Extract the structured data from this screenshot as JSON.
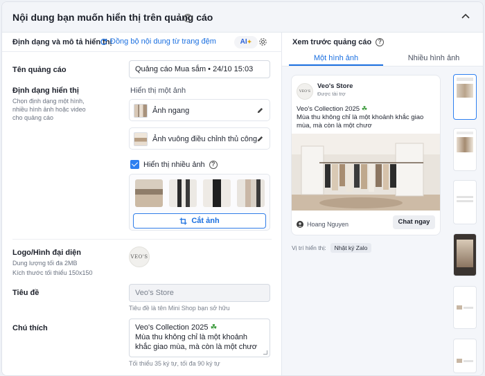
{
  "header": {
    "title": "Nội dung bạn muốn hiển thị trên quảng cáo"
  },
  "left": {
    "section_title": "Định dạng và mô tả hiển thị",
    "sync_label": "Đồng bộ nội dung từ trang đệm",
    "ai_label": "AI",
    "ad_name": {
      "label": "Tên quảng cáo",
      "value": "Quảng cáo Mua sắm • 24/10 15:03"
    },
    "format": {
      "label": "Định dạng hiển thị",
      "description": "Chọn định dạng một hình, nhiều hình ảnh hoặc video cho quảng cáo",
      "single_image_label": "Hiển thị một ảnh",
      "option_landscape": "Ảnh ngang",
      "option_square": "Ảnh vuông điều chỉnh thủ công",
      "multi_image_label": "Hiển thị nhiều ảnh",
      "crop_label": "Cắt ảnh"
    },
    "logo": {
      "label": "Logo/Hình đại diện",
      "desc1": "Dung lượng tối đa 2MB",
      "desc2": "Kích thước tối thiểu 150x150",
      "logo_text": "VEO'S"
    },
    "title": {
      "label": "Tiêu đề",
      "placeholder": "Veo's Store",
      "hint": "Tiêu đề là tên Mini Shop bạn sở hữu"
    },
    "caption": {
      "label": "Chú thích",
      "line1": "Veo's Collection 2025",
      "line2": "Mùa thu không chỉ là một khoảnh khắc giao mùa, mà còn là một chươ",
      "hint": "Tối thiểu 35 ký tự, tối đa 90 ký tự"
    }
  },
  "right": {
    "title": "Xem trước quảng cáo",
    "tabs": [
      "Một hình ảnh",
      "Nhiều hình ảnh"
    ],
    "card": {
      "store": "Veo's Store",
      "sponsored": "Được tài trợ",
      "logo_text": "VEO'S",
      "line1": "Veo's Collection 2025",
      "line2": "Mùa thu không chỉ là một khoảnh khắc giao mùa, mà còn là một chươ",
      "user": "Hoang Nguyen",
      "cta": "Chat ngay"
    },
    "position_label": "Vị trí hiển thị:",
    "position_value": "Nhật ký Zalo"
  },
  "colors": {
    "accent": "#1a6fe0",
    "border": "#d4d9e1",
    "muted": "#7a818d"
  }
}
